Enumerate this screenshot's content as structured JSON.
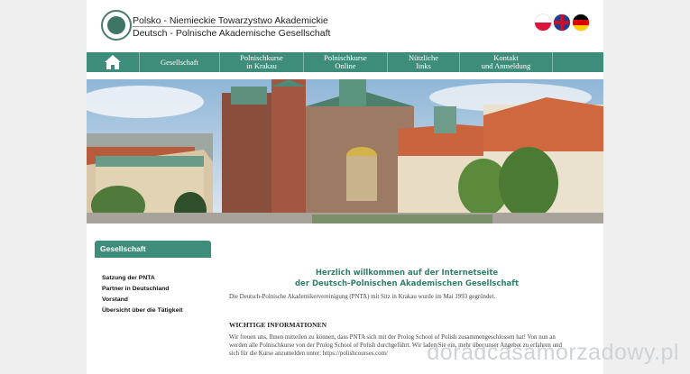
{
  "header": {
    "logo_line1": "Polsko - Niemieckie Towarzystwo Akademickie",
    "logo_line2": "Deutsch - Polnische Akademische Gesellschaft",
    "flags": [
      "flag-pl-icon",
      "flag-gb-icon",
      "flag-de-icon"
    ]
  },
  "nav": {
    "home_icon": "home-icon",
    "items": [
      {
        "line1": "Gesellschaft",
        "line2": ""
      },
      {
        "line1": "Polnischkurse",
        "line2": "in Krakau"
      },
      {
        "line1": "Polnischkurse",
        "line2": "Online"
      },
      {
        "line1": "Nützliche",
        "line2": "links"
      },
      {
        "line1": "Kontakt",
        "line2": "und Anmeldung"
      }
    ]
  },
  "sidebar": {
    "title": "Gesellschaft",
    "links": [
      "Satzung der PNTA",
      "Partner in Deutschland",
      "Vorstand",
      "Übersicht über die Tätigkeit"
    ]
  },
  "main": {
    "welcome_line1": "Herzlich willkommen auf der Internetseite",
    "welcome_line2": "der Deutsch-Polnischen Akademischen Gesellschaft",
    "intro": "Die Deutsch-Polnische Akademikervereinigung (PNTA) mit Sitz in Krakau wurde im Mai 1993 gegründet.",
    "info_heading": "WICHTIGE INFORMATIONEN",
    "info_line1": "Wir freuen uns, Ihnen mitteilen zu können, dass PNTA sich mit der Prolog School of Polish zusammengeschlossen hat! Von nun an",
    "info_line2": "werden alle Polnischkurse von der Prolog School of Polish durchgeführt. Wir laden Sie ein, mehr über unser Angebot zu erfahren und",
    "info_line3": "sich für die Kurse anzumelden unter:  https://polishcourses.com/"
  },
  "watermark": "doradcasamorzadowy.pl",
  "colors": {
    "accent": "#3e8d7b",
    "heading": "#2f7f6b",
    "background": "#efefef"
  }
}
